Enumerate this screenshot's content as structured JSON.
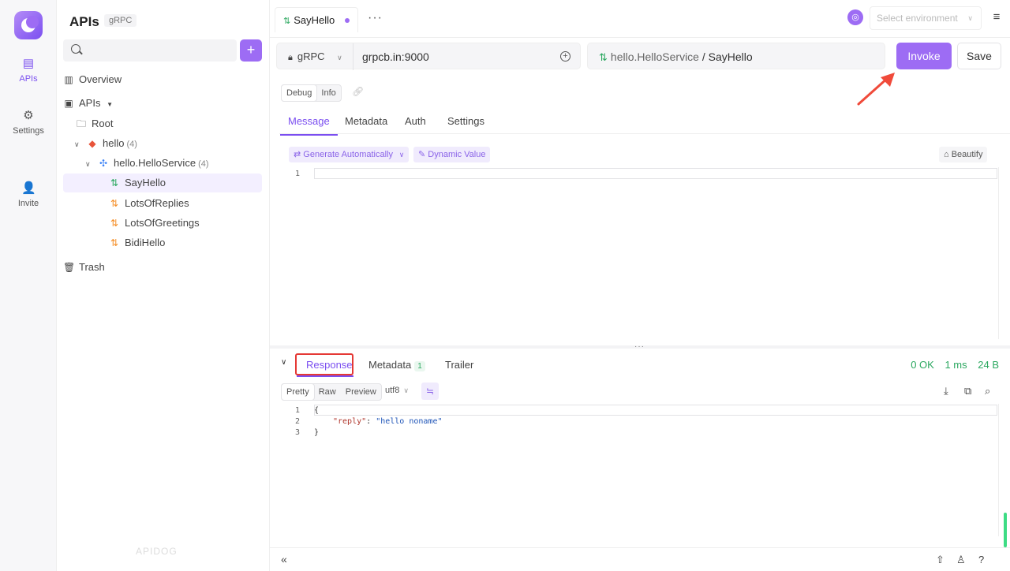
{
  "rail": {
    "items": [
      {
        "label": "APIs",
        "icon": "apis-icon"
      },
      {
        "label": "Settings",
        "icon": "settings-icon"
      },
      {
        "label": "Invite",
        "icon": "invite-icon"
      }
    ]
  },
  "sidebar": {
    "title": "APIs",
    "badge": "gRPC",
    "search_placeholder": "",
    "tree": [
      {
        "label": "Overview"
      },
      {
        "label": "APIs"
      },
      {
        "label": "Root"
      },
      {
        "label": "hello",
        "count": "(4)"
      },
      {
        "label": "hello.HelloService",
        "count": "(4)"
      },
      {
        "label": "SayHello"
      },
      {
        "label": "LotsOfReplies"
      },
      {
        "label": "LotsOfGreetings"
      },
      {
        "label": "BidiHello"
      },
      {
        "label": "Trash"
      }
    ],
    "watermark": "APIDOG"
  },
  "tabbar": {
    "tab_label": "SayHello",
    "env_placeholder": "Select environment"
  },
  "request": {
    "protocol": "gRPC",
    "host": "grpcb.in:9000",
    "service": "hello.HelloService",
    "separator": "/",
    "method": "SayHello",
    "invoke_label": "Invoke",
    "save_label": "Save"
  },
  "mode": {
    "debug": "Debug",
    "info": "Info"
  },
  "subtabs": [
    "Message",
    "Metadata",
    "Auth",
    "Settings"
  ],
  "message_tools": {
    "generate": "Generate Automatically",
    "dynamic": "Dynamic Value",
    "beautify": "Beautify"
  },
  "request_editor": {
    "lines": [
      "1"
    ]
  },
  "response": {
    "tabs": [
      "Response",
      "Metadata",
      "Trailer"
    ],
    "metadata_count": "1",
    "status": "0 OK",
    "time": "1 ms",
    "size": "24 B",
    "views": [
      "Pretty",
      "Raw",
      "Preview"
    ],
    "encoding": "utf8",
    "line_numbers": [
      "1",
      "2",
      "3"
    ],
    "code": {
      "open": "{",
      "key": "\"reply\"",
      "colon": ": ",
      "value": "\"hello noname\"",
      "close": "}"
    }
  },
  "colors": {
    "accent": "#9d6cf4",
    "success": "#2ca860",
    "highlight": "#e53935"
  }
}
